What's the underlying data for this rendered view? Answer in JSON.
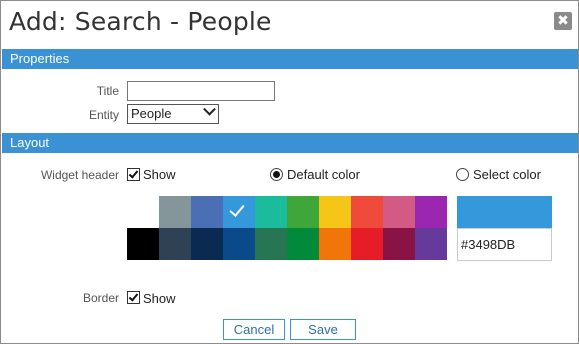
{
  "dialog": {
    "title": "Add: Search - People",
    "close_icon": "close-icon"
  },
  "properties": {
    "header": "Properties",
    "title_label": "Title",
    "title_value": "",
    "entity_label": "Entity",
    "entity_value": "People"
  },
  "layout": {
    "header": "Layout",
    "widget_header_label": "Widget header",
    "show_label": "Show",
    "widget_header_checked": true,
    "default_color_label": "Default color",
    "select_color_label": "Select color",
    "color_mode": "default",
    "palette": [
      [
        "#ffffff",
        "#85969a",
        "#4a6fb5",
        "#3498db",
        "#1abc9c",
        "#3fa63a",
        "#f5c518",
        "#f04a3b",
        "#d45a86",
        "#9b27b0"
      ],
      [
        "#000000",
        "#2f4154",
        "#0b2a52",
        "#0a4a8a",
        "#267553",
        "#008a3a",
        "#f0760a",
        "#e61d26",
        "#8a1346",
        "#663a9b"
      ]
    ],
    "selected_color": "#3498db",
    "hex_value": "#3498DB",
    "border_label": "Border",
    "border_show_label": "Show",
    "border_checked": true
  },
  "footer": {
    "cancel_label": "Cancel",
    "save_label": "Save"
  }
}
